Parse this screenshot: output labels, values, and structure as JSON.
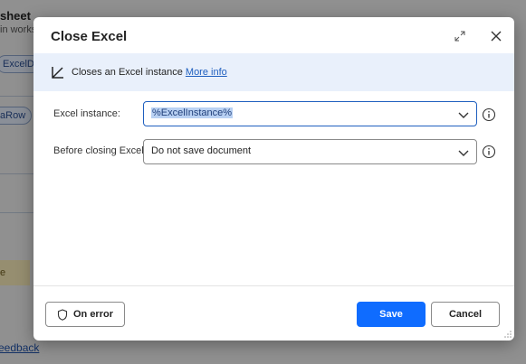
{
  "background": {
    "title": "sheet",
    "subtitle": "in works",
    "pill1": "ExcelD",
    "pill2": "taRow",
    "yellow_text": "e",
    "link": "eedback"
  },
  "dialog": {
    "title": "Close Excel",
    "info": {
      "text": "Closes an Excel instance",
      "link": "More info"
    },
    "fields": {
      "excel_instance": {
        "label": "Excel instance:",
        "value": "%ExcelInstance%"
      },
      "before_closing": {
        "label": "Before closing Excel:",
        "value": "Do not save document"
      }
    },
    "buttons": {
      "on_error": "On error",
      "save": "Save",
      "cancel": "Cancel"
    }
  },
  "colors": {
    "accent": "#0f6cff",
    "info_bg": "#e9f0fb",
    "link": "#1f5fbf"
  }
}
